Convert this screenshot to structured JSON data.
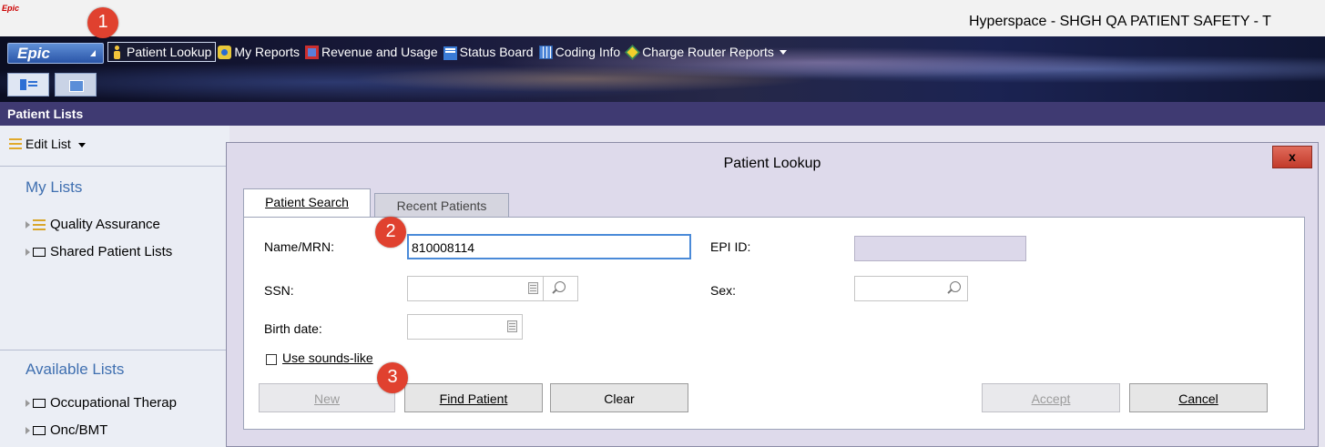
{
  "window": {
    "title": "Hyperspace - SHGH QA PATIENT SAFETY - T",
    "small_logo": "Epic"
  },
  "epic_button": {
    "label": "Epic"
  },
  "toolbar": {
    "items": [
      {
        "label": "Patient Lookup",
        "icon": "person-icon"
      },
      {
        "label": "My Reports",
        "icon": "reports-icon"
      },
      {
        "label": "Revenue and Usage",
        "icon": "revenue-icon"
      },
      {
        "label": "Status Board",
        "icon": "status-board-icon"
      },
      {
        "label": "Coding Info",
        "icon": "coding-info-icon"
      },
      {
        "label": "Charge Router Reports",
        "icon": "charge-router-icon"
      }
    ]
  },
  "patient_lists": {
    "header": "Patient Lists",
    "edit_list": "Edit List",
    "my_lists_title": "My Lists",
    "my_lists": [
      "Quality Assurance",
      "Shared Patient Lists"
    ],
    "available_lists_title": "Available Lists",
    "available_lists": [
      "Occupational Therap",
      "Onc/BMT"
    ]
  },
  "dialog": {
    "title": "Patient Lookup",
    "close": "x",
    "tabs": [
      "Patient Search",
      "Recent Patients"
    ],
    "labels": {
      "name_mrn": "Name/MRN:",
      "ssn": "SSN:",
      "birth_date": "Birth date:",
      "epi_id": "EPI ID:",
      "sex": "Sex:",
      "sounds_like": "Use sounds-like"
    },
    "values": {
      "name_mrn": "810008114",
      "ssn": "",
      "birth_date": "",
      "epi_id": "",
      "sex": ""
    },
    "buttons": {
      "new": "New",
      "find_patient": "Find Patient",
      "clear": "Clear",
      "accept": "Accept",
      "cancel": "Cancel"
    }
  },
  "badges": [
    "1",
    "2",
    "3"
  ],
  "colors": {
    "badge": "#e0412f",
    "header": "#3f3a72",
    "focus": "#4a8ad8"
  }
}
